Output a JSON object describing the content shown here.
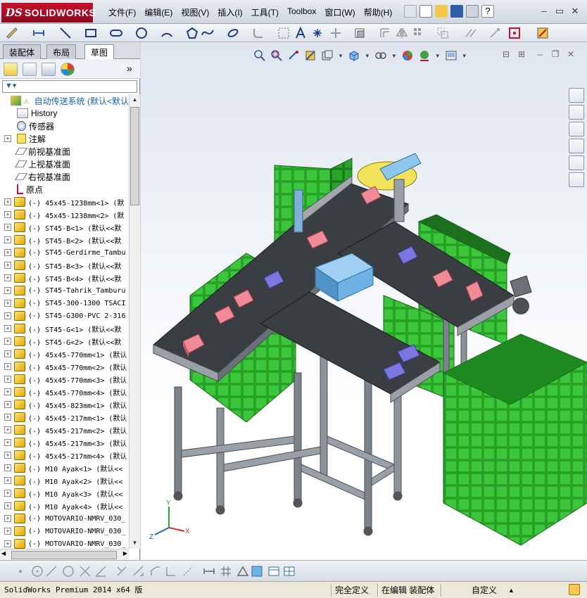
{
  "app": {
    "logo_ds": "DS",
    "logo_name": "SOLIDWORKS"
  },
  "menu": [
    "文件(F)",
    "编辑(E)",
    "视图(V)",
    "插入(I)",
    "工具(T)",
    "Toolbox",
    "窗口(W)",
    "帮助(H)"
  ],
  "tabs": [
    "装配体",
    "布局",
    "草图"
  ],
  "active_tab": "草图",
  "tree": {
    "root_label": "自动传送系统  (默认<默认",
    "features": [
      {
        "label": "History",
        "icon": "history-icon"
      },
      {
        "label": "传感器",
        "icon": "sensor-icon"
      },
      {
        "label": "注解",
        "icon": "annotation-icon",
        "expandable": true
      },
      {
        "label": "前视基准面",
        "icon": "plane-icon"
      },
      {
        "label": "上视基准面",
        "icon": "plane-icon"
      },
      {
        "label": "右视基准面",
        "icon": "plane-icon"
      },
      {
        "label": "原点",
        "icon": "origin-icon"
      }
    ],
    "parts": [
      "(-) 45x45-1238mm<1> (默",
      "(-) 45x45-1238mm<2> (默",
      "(-) ST45-B<1> (默认<<默",
      "(-) ST45-B<2> (默认<<默",
      "(-) ST45-Gerdirme_Tambu",
      "(-) ST45-B<3> (默认<<默",
      "(-) ST45-B<4> (默认<<默",
      "(-) ST45-Tahrik_Tamburu",
      "(-) ST45-300-1300 TSACI",
      "(-) ST45-G300-PVC 2-316",
      "(-) ST45-G<1> (默认<<默",
      "(-) ST45-G<2> (默认<<默",
      "(-) 45x45-770mm<1> (默认",
      "(-) 45x45-770mm<2> (默认",
      "(-) 45x45-770mm<3> (默认",
      "(-) 45x45-770mm<4> (默认",
      "(-) 45x45-823mm<1> (默认",
      "(-) 45x45-217mm<1> (默认",
      "(-) 45x45-217mm<2> (默认",
      "(-) 45x45-217mm<3> (默认",
      "(-) 45x45-217mm<4> (默认",
      "(-) M10 Ayak<1> (默认<<",
      "(-) M10 Ayak<2> (默认<<",
      "(-) M10 Ayak<3> (默认<<",
      "(-) M10 Ayak<4> (默认<<",
      "(-) MOTOVARIO-NMRV_030_",
      "(-) MOTOVARIO-NMRV_030_",
      "(-) MOTOVARIO-NMRV_030_"
    ]
  },
  "triad": {
    "x": "X",
    "y": "Y",
    "z": "Z"
  },
  "status": {
    "version": "SolidWorks Premium 2014 x64 版",
    "definition": "完全定义",
    "editing": "在编辑 装配体",
    "units": "自定义"
  },
  "colors": {
    "bin_green": "#2fb52f",
    "belt_dark": "#3a3d42",
    "frame_gray": "#9aa0a8",
    "box_pink": "#f08a96",
    "box_purple": "#7a78e0",
    "box_blue": "#6fb3e6",
    "accent_red": "#c8102e"
  }
}
